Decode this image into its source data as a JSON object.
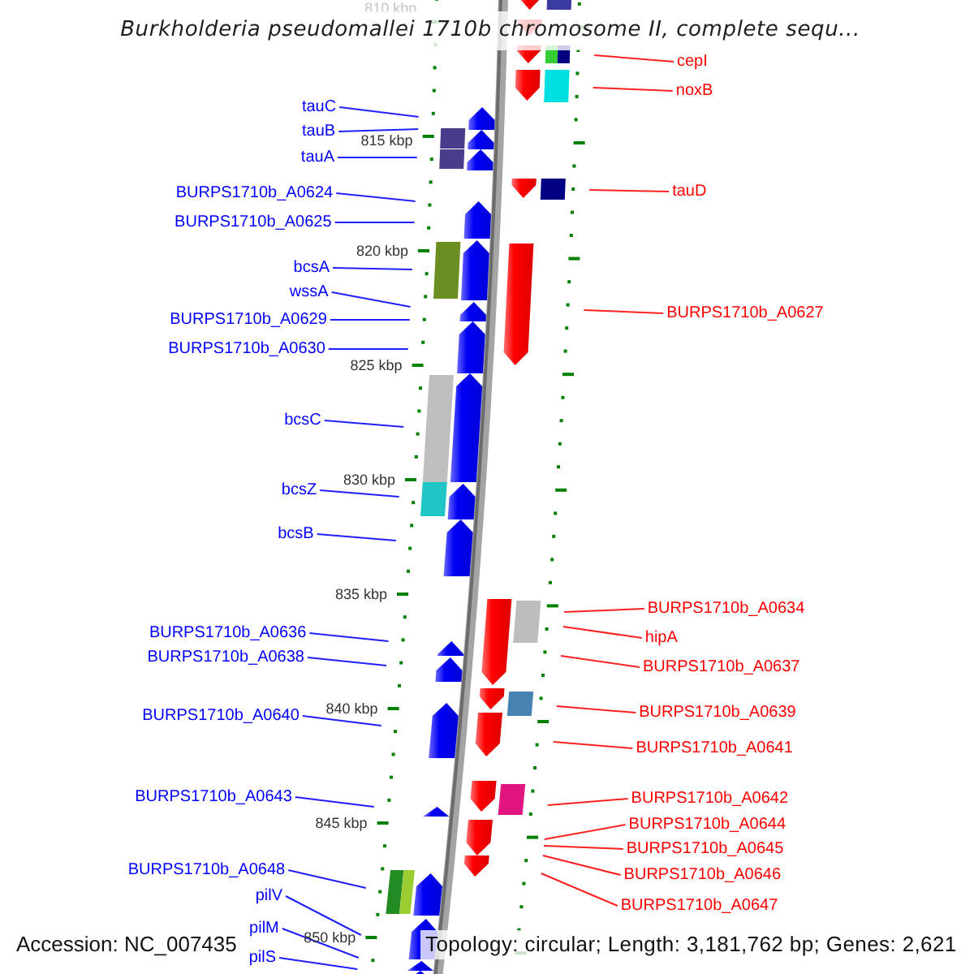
{
  "title": "Burkholderia pseudomallei 1710b chromosome II, complete sequ...",
  "map": {
    "scale_labels": [
      {
        "label": "810 kbp",
        "faded": true
      },
      {
        "label": "815 kbp",
        "faded": false
      },
      {
        "label": "820 kbp",
        "faded": false
      },
      {
        "label": "825 kbp",
        "faded": false
      },
      {
        "label": "830 kbp",
        "faded": false
      },
      {
        "label": "835 kbp",
        "faded": false
      },
      {
        "label": "840 kbp",
        "faded": false
      },
      {
        "label": "845 kbp",
        "faded": false
      },
      {
        "label": "850 kbp",
        "faded": false
      }
    ],
    "forward_labels": [
      "tauC",
      "tauB",
      "tauA",
      "BURPS1710b_A0624",
      "BURPS1710b_A0625",
      "bcsA",
      "wssA",
      "BURPS1710b_A0629",
      "BURPS1710b_A0630",
      "bcsC",
      "bcsZ",
      "bcsB",
      "BURPS1710b_A0636",
      "BURPS1710b_A0638",
      "BURPS1710b_A0640",
      "BURPS1710b_A0643",
      "BURPS1710b_A0648",
      "pilV",
      "pilM",
      "pilS"
    ],
    "reverse_labels": [
      "cepI",
      "noxB",
      "tauD",
      "BURPS1710b_A0627",
      "BURPS1710b_A0634",
      "hipA",
      "BURPS1710b_A0637",
      "BURPS1710b_A0639",
      "BURPS1710b_A0641",
      "BURPS1710b_A0642",
      "BURPS1710b_A0644",
      "BURPS1710b_A0645",
      "BURPS1710b_A0646",
      "BURPS1710b_A0647"
    ],
    "feature_blocks": [
      {
        "color": "#3a3aa0"
      },
      {
        "color": "#33cc33"
      },
      {
        "color": "#000080"
      },
      {
        "color": "#00e0e0"
      },
      {
        "color": "#483d8b"
      },
      {
        "color": "#483d8b"
      },
      {
        "color": "#000080"
      },
      {
        "color": "#6b8e23"
      },
      {
        "color": "#bebebe"
      },
      {
        "color": "#20c5c5"
      },
      {
        "color": "#bdbdbd"
      },
      {
        "color": "#4682b4"
      },
      {
        "color": "#e0157f"
      },
      {
        "color": "#228b22"
      },
      {
        "color": "#9acd32"
      }
    ]
  },
  "footer": {
    "accession": "Accession: NC_007435",
    "summary": "Topology: circular; Length: 3,181,762 bp; Genes: 2,621"
  }
}
